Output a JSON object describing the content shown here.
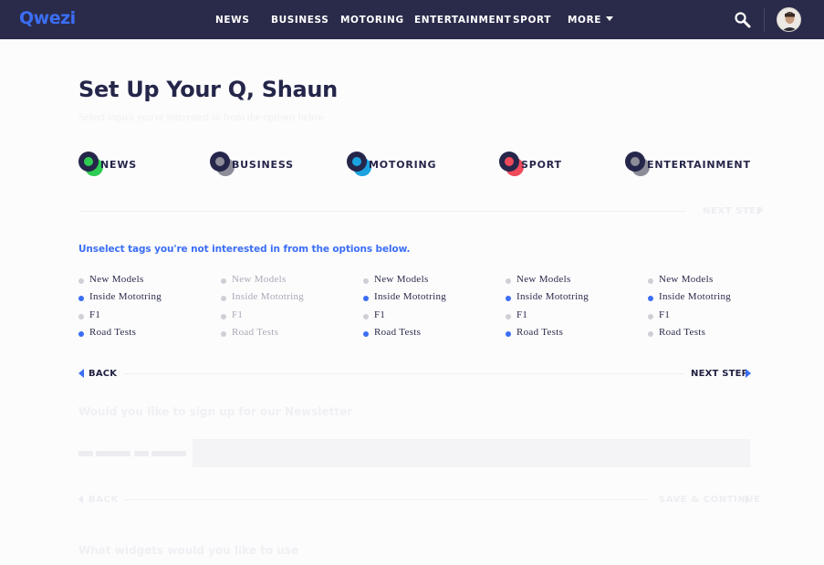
{
  "brand": {
    "logo_text": "Qwezi",
    "accent": "#3b6ef5",
    "nav_bg": "#2a2b4a"
  },
  "nav": {
    "items": [
      "NEWS",
      "BUSINESS",
      "MOTORING",
      "ENTERTAINMENT",
      "SPORT"
    ],
    "more_label": "MORE",
    "search_icon": "search-icon",
    "avatar_icon": "user-avatar"
  },
  "setup": {
    "title": "Set Up Your Q, Shaun",
    "subtitle": "Select topics you're interested in from the options below"
  },
  "categories": [
    {
      "label": "NEWS",
      "color": "#2ecc52"
    },
    {
      "label": "BUSINESS",
      "color": "#8d8d99"
    },
    {
      "label": "MOTORING",
      "color": "#1aa3e0"
    },
    {
      "label": "SPORT",
      "color": "#f04a5a"
    },
    {
      "label": "ENTERTAINMENT",
      "color": "#8d8d99"
    }
  ],
  "step1": {
    "next_label": "NEXT STEP"
  },
  "tags": {
    "instruction": "Unselect tags you're not interested in from the options below.",
    "columns": [
      {
        "dim": false,
        "items": [
          {
            "label": "New Models",
            "selected": false
          },
          {
            "label": "Inside Mototring",
            "selected": true
          },
          {
            "label": "F1",
            "selected": false
          },
          {
            "label": "Road Tests",
            "selected": true
          }
        ]
      },
      {
        "dim": true,
        "items": [
          {
            "label": "New Models",
            "selected": false
          },
          {
            "label": "Inside Mototring",
            "selected": false
          },
          {
            "label": "F1",
            "selected": false
          },
          {
            "label": "Road Tests",
            "selected": false
          }
        ]
      },
      {
        "dim": false,
        "items": [
          {
            "label": "New Models",
            "selected": false
          },
          {
            "label": "Inside Mototring",
            "selected": true
          },
          {
            "label": "F1",
            "selected": false
          },
          {
            "label": "Road Tests",
            "selected": true
          }
        ]
      },
      {
        "dim": false,
        "items": [
          {
            "label": "New Models",
            "selected": false
          },
          {
            "label": "Inside Mototring",
            "selected": true
          },
          {
            "label": "F1",
            "selected": false
          },
          {
            "label": "Road Tests",
            "selected": true
          }
        ]
      },
      {
        "dim": false,
        "items": [
          {
            "label": "New Models",
            "selected": false
          },
          {
            "label": "Inside Mototring",
            "selected": true
          },
          {
            "label": "F1",
            "selected": false
          },
          {
            "label": "Road Tests",
            "selected": false
          }
        ]
      }
    ],
    "back_label": "BACK",
    "next_label": "NEXT STEP"
  },
  "newsletter": {
    "question": "Would you like to sign up for our Newsletter",
    "back_label": "BACK",
    "continue_label": "SAVE & CONTINUE"
  },
  "widgets": {
    "question": "What widgets would you like to use"
  }
}
